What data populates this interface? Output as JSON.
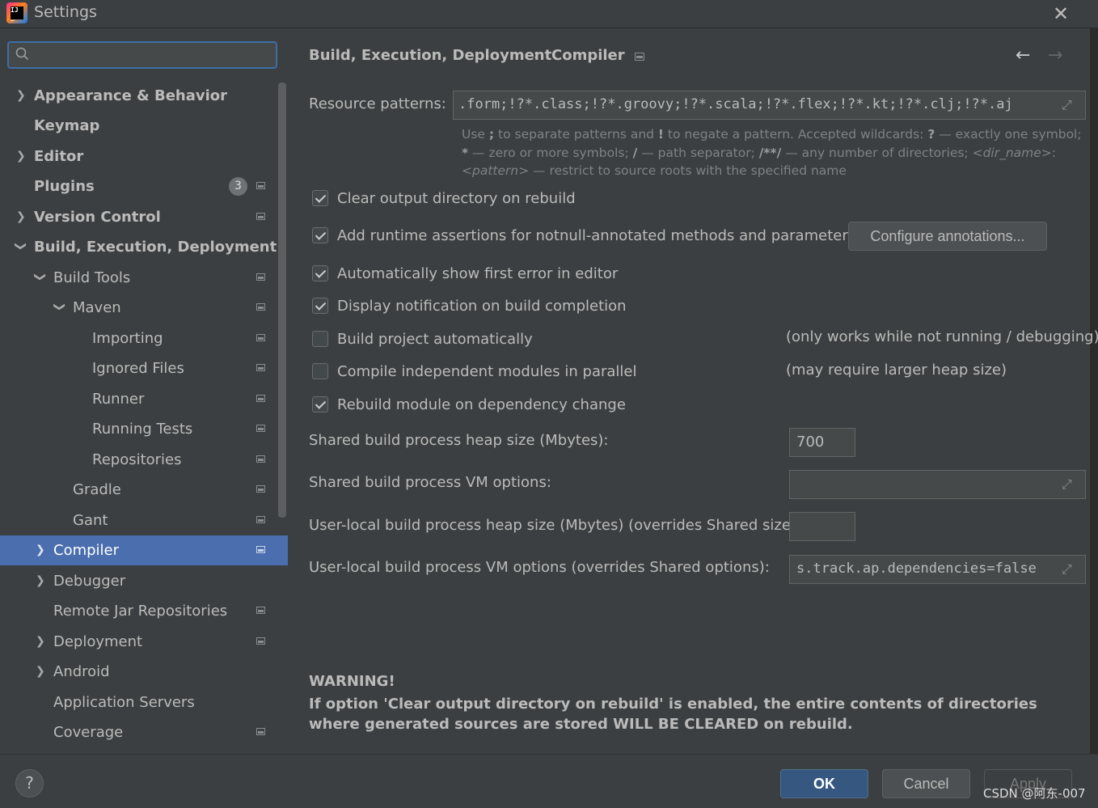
{
  "window": {
    "title": "Settings"
  },
  "search": {
    "placeholder": ""
  },
  "sidebar": {
    "items": [
      {
        "label": "Appearance & Behavior",
        "bold": true
      },
      {
        "label": "Keymap",
        "bold": true
      },
      {
        "label": "Editor",
        "bold": true
      },
      {
        "label": "Plugins",
        "bold": true,
        "badge": "3"
      },
      {
        "label": "Version Control",
        "bold": true
      },
      {
        "label": "Build, Execution, Deployment",
        "bold": true
      },
      {
        "label": "Build Tools"
      },
      {
        "label": "Maven"
      },
      {
        "label": "Importing"
      },
      {
        "label": "Ignored Files"
      },
      {
        "label": "Runner"
      },
      {
        "label": "Running Tests"
      },
      {
        "label": "Repositories"
      },
      {
        "label": "Gradle"
      },
      {
        "label": "Gant"
      },
      {
        "label": "Compiler"
      },
      {
        "label": "Debugger"
      },
      {
        "label": "Remote Jar Repositories"
      },
      {
        "label": "Deployment"
      },
      {
        "label": "Android"
      },
      {
        "label": "Application Servers"
      },
      {
        "label": "Coverage"
      }
    ]
  },
  "breadcrumb": {
    "parent": "Build, Execution, Deployment",
    "separator": "›",
    "current": "Compiler"
  },
  "nav": {
    "back": "←",
    "forward": "→"
  },
  "resource": {
    "label": "Resource patterns:",
    "value": ".form;!?*.class;!?*.groovy;!?*.scala;!?*.flex;!?*.kt;!?*.clj;!?*.aj",
    "hint_1": "Use ",
    "hint_2": ";",
    "hint_3": " to separate patterns and ",
    "hint_4": "!",
    "hint_5": " to negate a pattern. Accepted wildcards: ",
    "hint_6": "?",
    "hint_7": " — exactly one symbol; ",
    "hint_8": "*",
    "hint_9": " — zero or more symbols; ",
    "hint_10": "/",
    "hint_11": " — path separator; ",
    "hint_12": "/**/",
    "hint_13": " — any number of directories; ",
    "hint_14": "<dir_name>",
    "hint_15": ": ",
    "hint_16": "<pattern>",
    "hint_17": " — restrict to source roots with the specified name"
  },
  "options": {
    "clear_output": "Clear output directory on rebuild",
    "runtime_assertions": "Add runtime assertions for notnull-annotated methods and parameters",
    "configure_button": "Configure annotations...",
    "show_first_error": "Automatically show first error in editor",
    "display_notification": "Display notification on build completion",
    "build_auto": "Build project automatically",
    "build_auto_note": "(only works while not running / debugging)",
    "compile_parallel": "Compile independent modules in parallel",
    "compile_parallel_note": "(may require larger heap size)",
    "rebuild_dependency": "Rebuild module on dependency change"
  },
  "fields": {
    "shared_heap_label": "Shared build process heap size (Mbytes):",
    "shared_heap_value": "700",
    "shared_vm_label": "Shared build process VM options:",
    "shared_vm_value": "",
    "user_heap_label": "User-local build process heap size (Mbytes) (overrides Shared size):",
    "user_heap_value": "",
    "user_vm_label": "User-local build process VM options (overrides Shared options):",
    "user_vm_value": "s.track.ap.dependencies=false"
  },
  "warning": {
    "title": "WARNING!",
    "text": "If option 'Clear output directory on rebuild' is enabled, the entire contents of directories where generated sources are stored WILL BE CLEARED on rebuild."
  },
  "footer": {
    "help": "?",
    "ok": "OK",
    "cancel": "Cancel",
    "apply": "Apply",
    "watermark": "CSDN @阿东-007"
  },
  "colors": {
    "selection": "#4b6eaf",
    "ok_button": "#365880",
    "focus_border": "#3d6ea8"
  }
}
